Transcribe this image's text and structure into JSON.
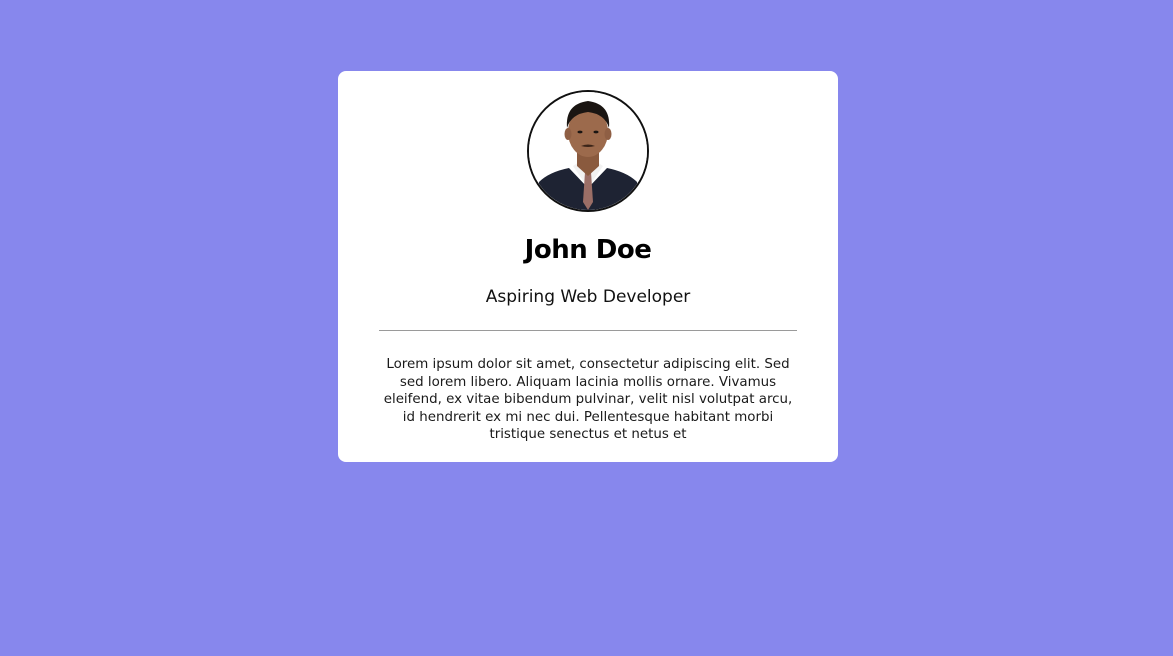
{
  "page": {
    "background_color": "#8787ed"
  },
  "profile_card": {
    "avatar_icon": "person-photo",
    "name": "John Doe",
    "title": "Aspiring Web Developer",
    "bio": "Lorem ipsum dolor sit amet, consectetur adipiscing elit. Sed sed lorem libero. Aliquam lacinia mollis ornare. Vivamus eleifend, ex vitae bibendum pulvinar, velit nisl volutpat arcu, id hendrerit ex mi nec dui. Pellentesque habitant morbi tristique senectus et netus et"
  }
}
